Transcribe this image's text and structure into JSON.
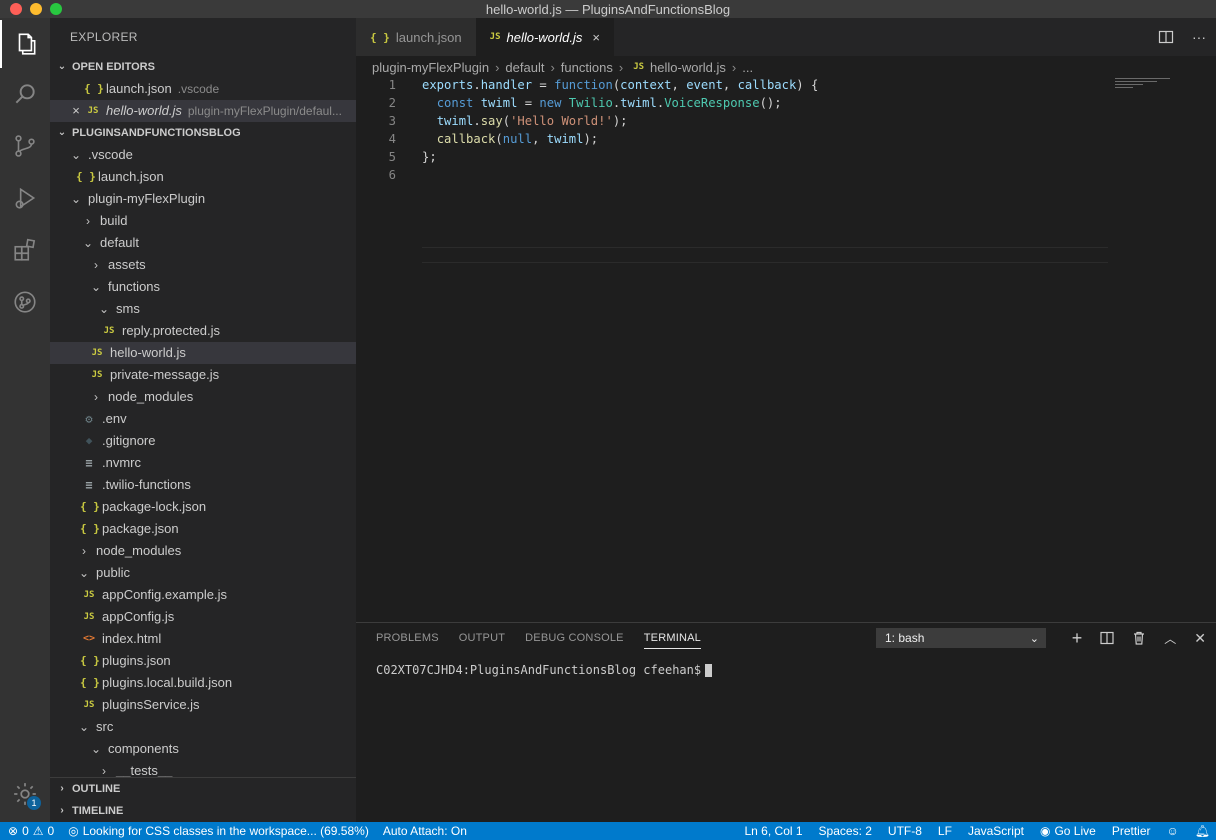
{
  "window": {
    "title": "hello-world.js — PluginsAndFunctionsBlog"
  },
  "activity_bar": {
    "items": [
      "files-icon",
      "search-icon",
      "source-control-icon",
      "run-debug-icon",
      "extensions-icon",
      "git-graph-icon"
    ],
    "settings_badge": "1"
  },
  "sidebar": {
    "title": "EXPLORER",
    "open_editors": {
      "header": "OPEN EDITORS",
      "items": [
        {
          "icon": "{ }",
          "label": "launch.json",
          "desc": ".vscode"
        },
        {
          "icon": "JS",
          "label": "hello-world.js",
          "desc": "plugin-myFlexPlugin/defaul..."
        }
      ]
    },
    "workspace": {
      "header": "PLUGINSANDFUNCTIONSBLOG",
      "rows": [
        {
          "chev": "⌄",
          "icon": "",
          "label": ".vscode"
        },
        {
          "chev": "",
          "icon": "{ }",
          "label": "launch.json"
        },
        {
          "chev": "⌄",
          "icon": "",
          "label": "plugin-myFlexPlugin"
        },
        {
          "chev": "›",
          "icon": "",
          "label": "build"
        },
        {
          "chev": "⌄",
          "icon": "",
          "label": "default"
        },
        {
          "chev": "›",
          "icon": "",
          "label": "assets"
        },
        {
          "chev": "⌄",
          "icon": "",
          "label": "functions"
        },
        {
          "chev": "⌄",
          "icon": "",
          "label": "sms"
        },
        {
          "chev": "",
          "icon": "JS",
          "label": "reply.protected.js"
        },
        {
          "chev": "",
          "icon": "JS",
          "label": "hello-world.js"
        },
        {
          "chev": "",
          "icon": "JS",
          "label": "private-message.js"
        },
        {
          "chev": "›",
          "icon": "",
          "label": "node_modules"
        },
        {
          "chev": "",
          "icon": "⚙",
          "label": ".env"
        },
        {
          "chev": "",
          "icon": "◆",
          "label": ".gitignore"
        },
        {
          "chev": "",
          "icon": "≡",
          "label": ".nvmrc"
        },
        {
          "chev": "",
          "icon": "≡",
          "label": ".twilio-functions"
        },
        {
          "chev": "",
          "icon": "{ }",
          "label": "package-lock.json"
        },
        {
          "chev": "",
          "icon": "{ }",
          "label": "package.json"
        },
        {
          "chev": "›",
          "icon": "",
          "label": "node_modules"
        },
        {
          "chev": "⌄",
          "icon": "",
          "label": "public"
        },
        {
          "chev": "",
          "icon": "JS",
          "label": "appConfig.example.js"
        },
        {
          "chev": "",
          "icon": "JS",
          "label": "appConfig.js"
        },
        {
          "chev": "",
          "icon": "<>",
          "label": "index.html"
        },
        {
          "chev": "",
          "icon": "{ }",
          "label": "plugins.json"
        },
        {
          "chev": "",
          "icon": "{ }",
          "label": "plugins.local.build.json"
        },
        {
          "chev": "",
          "icon": "JS",
          "label": "pluginsService.js"
        },
        {
          "chev": "⌄",
          "icon": "",
          "label": "src"
        },
        {
          "chev": "⌄",
          "icon": "",
          "label": "components"
        },
        {
          "chev": "›",
          "icon": "",
          "label": "__tests__"
        }
      ]
    },
    "outline": "OUTLINE",
    "timeline": "TIMELINE"
  },
  "tabs": [
    {
      "icon": "{ }",
      "label": "launch.json",
      "active": false
    },
    {
      "icon": "JS",
      "label": "hello-world.js",
      "active": true,
      "close": "×"
    }
  ],
  "breadcrumb": {
    "parts": [
      "plugin-myFlexPlugin",
      "default",
      "functions",
      "hello-world.js",
      "..."
    ],
    "sep": "›",
    "file_icon": "JS"
  },
  "editor": {
    "line_numbers": [
      "1",
      "2",
      "3",
      "4",
      "5",
      "6"
    ]
  },
  "panel": {
    "tabs": [
      "PROBLEMS",
      "OUTPUT",
      "DEBUG CONSOLE",
      "TERMINAL"
    ],
    "active_tab": "TERMINAL",
    "terminal_select": "1: bash",
    "prompt": "C02XT07CJHD4:PluginsAndFunctionsBlog cfeehan$"
  },
  "statusbar": {
    "errors": "0",
    "warnings": "0",
    "message": "Looking for CSS classes in the workspace... (69.58%)",
    "auto_attach": "Auto Attach: On",
    "position": "Ln 6, Col 1",
    "spaces": "Spaces: 2",
    "encoding": "UTF-8",
    "eol": "LF",
    "language": "JavaScript",
    "go_live": "Go Live",
    "prettier": "Prettier"
  }
}
